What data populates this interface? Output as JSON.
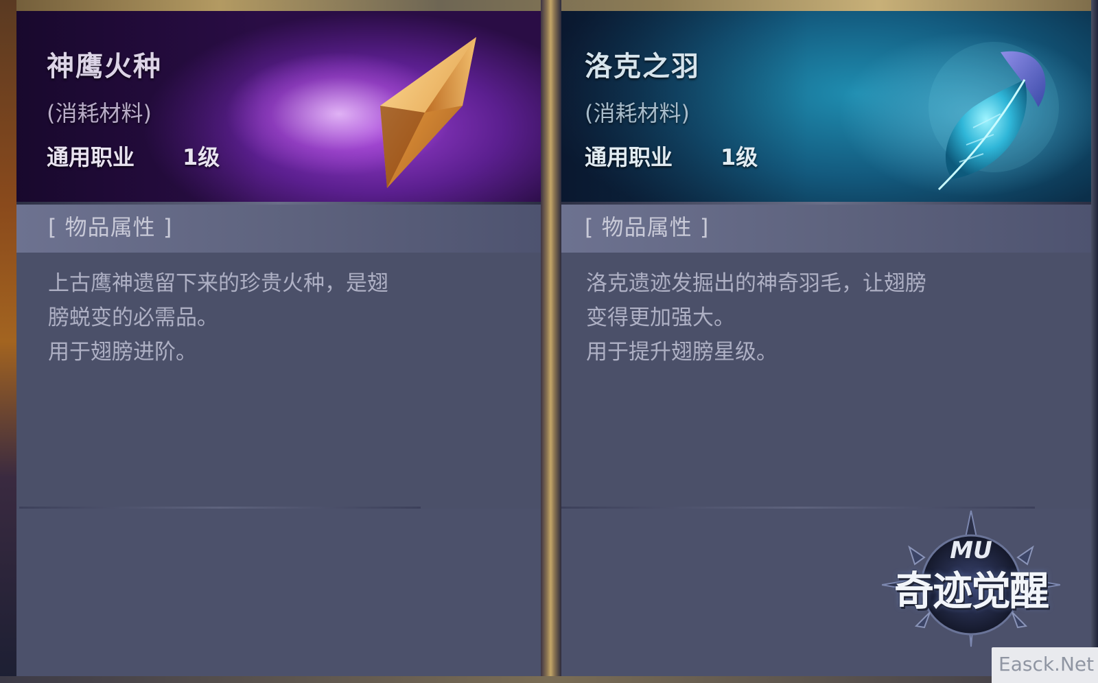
{
  "cards": [
    {
      "name": "神鹰火种",
      "type": "(消耗材料)",
      "class": "通用职业",
      "level": "1级",
      "section_title": "[ 物品属性 ]",
      "description": [
        "上古鹰神遗留下来的珍贵火种，是翅",
        "膀蜕变的必需品。",
        "用于翅膀进阶。"
      ],
      "icon": "golden-crystal-icon",
      "theme_color": "#7a2fb5"
    },
    {
      "name": "洛克之羽",
      "type": "(消耗材料)",
      "class": "通用职业",
      "level": "1级",
      "section_title": "[ 物品属性 ]",
      "description": [
        "洛克遗迹发掘出的神奇羽毛，让翅膀",
        "变得更加强大。",
        "用于提升翅膀星级。"
      ],
      "icon": "cyan-feather-icon",
      "theme_color": "#1a7fa3"
    }
  ],
  "logo": {
    "mu": "MU",
    "wordmark": "奇迹觉醒"
  },
  "watermark": "Easck.Net"
}
